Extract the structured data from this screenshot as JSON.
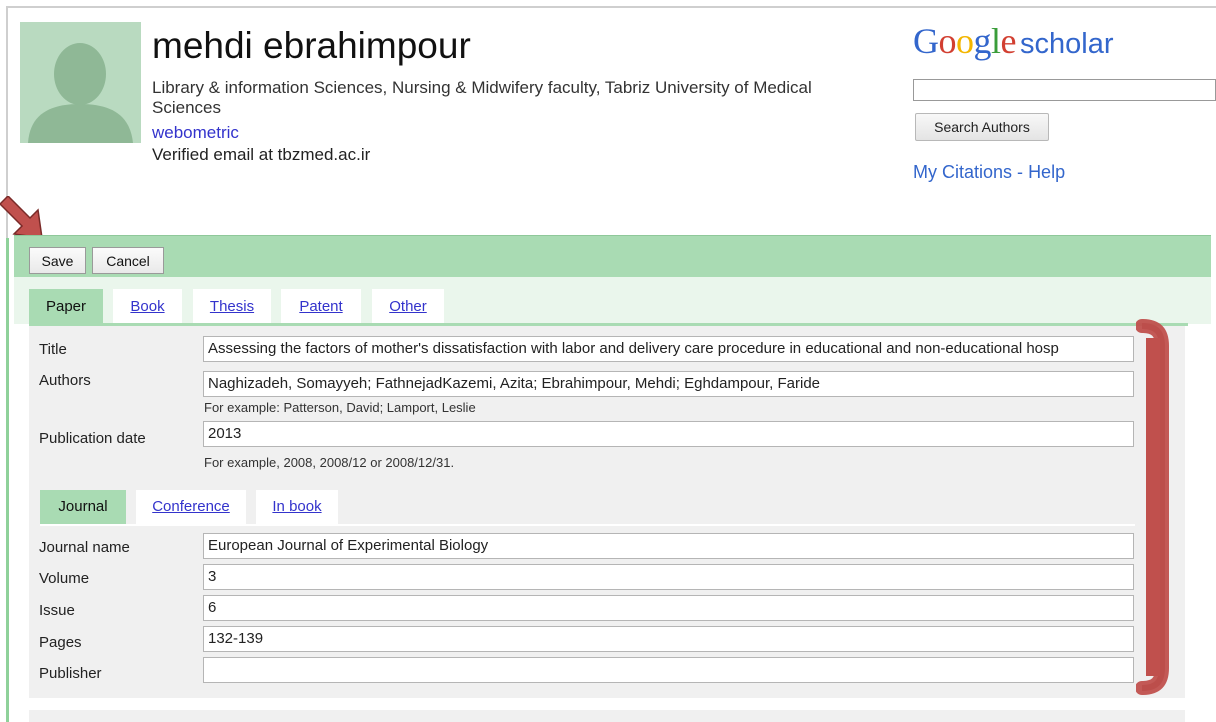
{
  "profile": {
    "name": "mehdi ebrahimpour",
    "affiliation": "Library & information Sciences, Nursing & Midwifery faculty, Tabriz University of Medical Sciences",
    "keyword": "webometric",
    "email": "Verified email at tbzmed.ac.ir"
  },
  "header": {
    "logo_google": [
      "G",
      "o",
      "o",
      "g",
      "l",
      "e"
    ],
    "logo_scholar": "scholar",
    "search_value": "",
    "search_button": "Search Authors",
    "my_citations": "My Citations",
    "separator": "-",
    "help": "Help"
  },
  "toolbar": {
    "save_label": "Save",
    "cancel_label": "Cancel"
  },
  "pub_tabs": [
    {
      "label": "Paper",
      "active": true
    },
    {
      "label": "Book",
      "active": false
    },
    {
      "label": "Thesis",
      "active": false
    },
    {
      "label": "Patent",
      "active": false
    },
    {
      "label": "Other",
      "active": false
    }
  ],
  "form": {
    "title_label": "Title",
    "title_value": "Assessing the factors of mother's dissatisfaction with labor and delivery care procedure in educational and non-educational hosp",
    "authors_label": "Authors",
    "authors_value": "Naghizadeh, Somayyeh; FathnejadKazemi, Azita; Ebrahimpour, Mehdi; Eghdampour, Faride",
    "authors_hint": "For example: Patterson, David; Lamport, Leslie",
    "date_label": "Publication date",
    "date_value": "2013",
    "date_hint": "For example, 2008, 2008/12 or 2008/12/31.",
    "venue_tabs": [
      {
        "label": "Journal",
        "active": true
      },
      {
        "label": "Conference",
        "active": false
      },
      {
        "label": "In book",
        "active": false
      }
    ],
    "journal_label": "Journal name",
    "journal_value": "European Journal of Experimental Biology",
    "volume_label": "Volume",
    "volume_value": "3",
    "issue_label": "Issue",
    "issue_value": "6",
    "pages_label": "Pages",
    "pages_value": "132-139",
    "publisher_label": "Publisher",
    "publisher_value": ""
  },
  "colors": {
    "accent_green": "#a9dbb3",
    "link_blue": "#3333cc",
    "annotation_red": "#c0504d"
  }
}
